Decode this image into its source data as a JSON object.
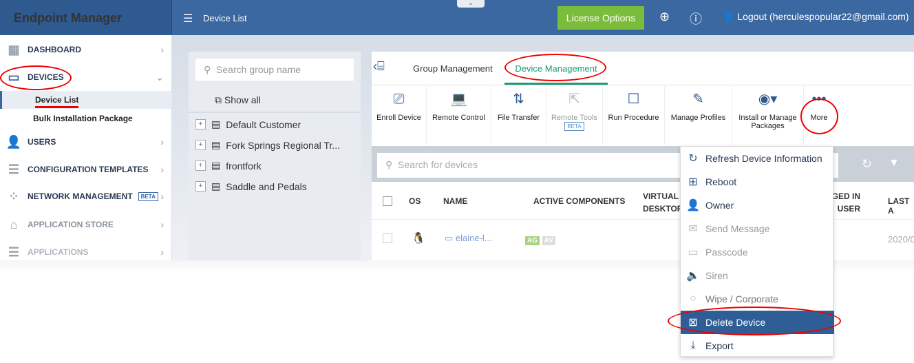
{
  "header": {
    "brand": "Endpoint Manager",
    "page_title": "Device List",
    "license_button": "License Options",
    "logout": "Logout (herculespopular22@gmail.com)",
    "accent": "#3b68a0"
  },
  "sidebar": {
    "items": [
      {
        "label": "DASHBOARD",
        "icon": "dashboard-icon"
      },
      {
        "label": "DEVICES",
        "icon": "devices-icon",
        "expanded": true
      },
      {
        "label": "USERS",
        "icon": "user-icon"
      },
      {
        "label": "CONFIGURATION TEMPLATES",
        "icon": "templates-icon"
      },
      {
        "label": "NETWORK MANAGEMENT",
        "icon": "network-icon",
        "badge": "BETA"
      },
      {
        "label": "APPLICATION STORE",
        "icon": "store-icon"
      },
      {
        "label": "APPLICATIONS",
        "icon": "applications-icon"
      }
    ],
    "sub_items": [
      {
        "label": "Device List",
        "active": true
      },
      {
        "label": "Bulk Installation Package"
      }
    ]
  },
  "groups": {
    "search_placeholder": "Search group name",
    "show_all": "Show all",
    "items": [
      "Default Customer",
      "Fork Springs Regional Tr...",
      "frontfork",
      "Saddle and Pedals"
    ]
  },
  "tabs": [
    {
      "label": "Group Management"
    },
    {
      "label": "Device Management",
      "active": true
    }
  ],
  "toolbar": [
    {
      "label": "Enroll Device"
    },
    {
      "label": "Remote Control"
    },
    {
      "label": "File Transfer"
    },
    {
      "label": "Remote Tools",
      "badge": "BETA",
      "disabled": true
    },
    {
      "label": "Run Procedure"
    },
    {
      "label": "Manage Profiles"
    },
    {
      "label": "Install or Manage Packages"
    },
    {
      "label": "More"
    }
  ],
  "devices": {
    "search_placeholder": "Search for devices",
    "columns": [
      "OS",
      "NAME",
      "ACTIVE COMPONENTS",
      "VIRTUAL DESKTOP",
      "LOGGED IN USER",
      "LAST A"
    ],
    "rows": [
      {
        "name": "elaine-l...",
        "components": [
          "AG",
          "AV"
        ],
        "last": "2020/0"
      }
    ]
  },
  "more_menu": [
    {
      "label": "Refresh Device Information",
      "icon": "refresh-icon"
    },
    {
      "label": "Reboot",
      "icon": "reboot-icon"
    },
    {
      "label": "Owner",
      "icon": "owner-icon"
    },
    {
      "label": "Send Message",
      "icon": "message-icon",
      "disabled": true
    },
    {
      "label": "Passcode",
      "icon": "passcode-icon",
      "disabled": true
    },
    {
      "label": "Siren",
      "icon": "siren-icon",
      "disabled": true
    },
    {
      "label": "Wipe / Corporate",
      "icon": "wipe-icon",
      "disabled": true
    },
    {
      "label": "Delete Device",
      "icon": "delete-device-icon",
      "selected": true
    },
    {
      "label": "Export",
      "icon": "export-icon"
    }
  ]
}
